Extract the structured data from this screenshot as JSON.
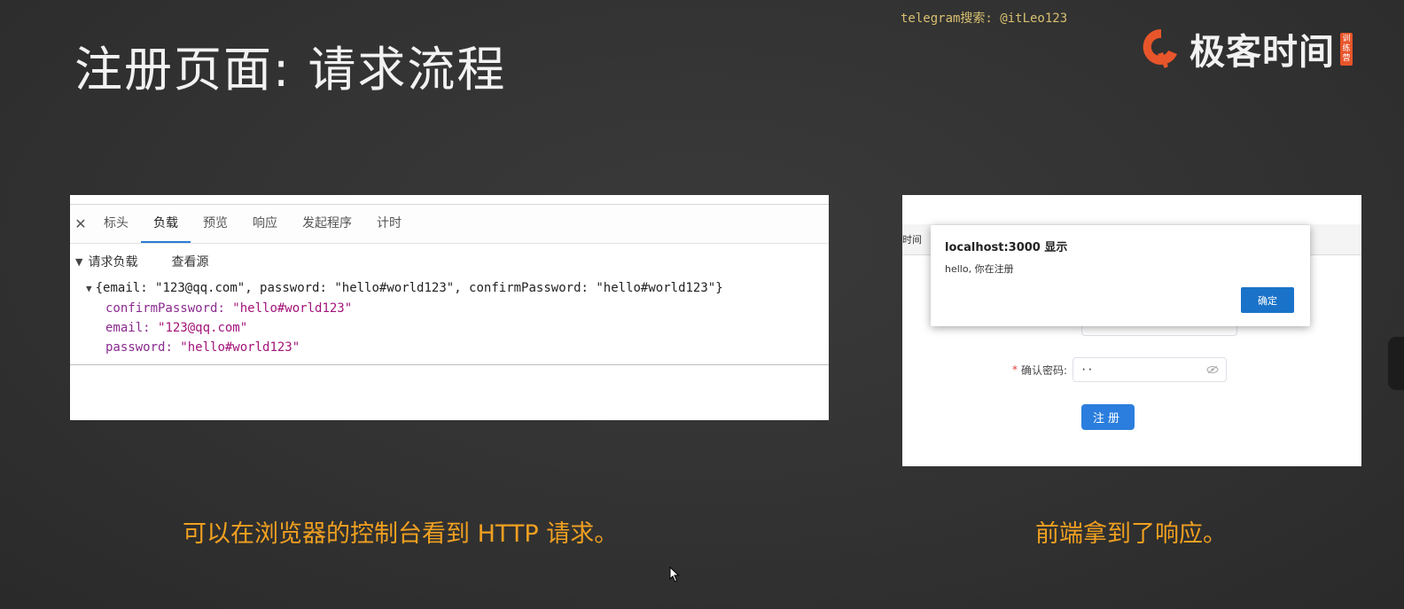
{
  "slide": {
    "title": "注册页面: 请求流程",
    "watermark": "telegram搜索: @itLeo123",
    "brand": {
      "name": "极客时间",
      "badge": "训练营"
    }
  },
  "devtools": {
    "tabs": [
      {
        "label": "标头",
        "active": false
      },
      {
        "label": "负载",
        "active": true
      },
      {
        "label": "预览",
        "active": false
      },
      {
        "label": "响应",
        "active": false
      },
      {
        "label": "发起程序",
        "active": false
      },
      {
        "label": "计时",
        "active": false
      }
    ],
    "section_label": "请求负载",
    "view_source": "查看源",
    "payload_summary": "{email: \"123@qq.com\", password: \"hello#world123\", confirmPassword: \"hello#world123\"}",
    "fields": [
      {
        "key": "confirmPassword",
        "value": "\"hello#world123\""
      },
      {
        "key": "email",
        "value": "\"123@qq.com\""
      },
      {
        "key": "password",
        "value": "\"hello#world123\""
      }
    ]
  },
  "browser": {
    "bar_text": "时间",
    "alert": {
      "title": "localhost:3000 显示",
      "message": "hello, 你在注册",
      "ok_label": "确定"
    },
    "confirm_password_label": "确认密码:",
    "confirm_password_value": "··",
    "submit_label": "注册"
  },
  "captions": {
    "left": "可以在浏览器的控制台看到 HTTP 请求。",
    "right": "前端拿到了响应。"
  },
  "colors": {
    "caption": "#f0a020",
    "brand_accent": "#e8552a",
    "active_tab_underline": "#2a7bd6",
    "primary_button": "#2b7ede"
  }
}
